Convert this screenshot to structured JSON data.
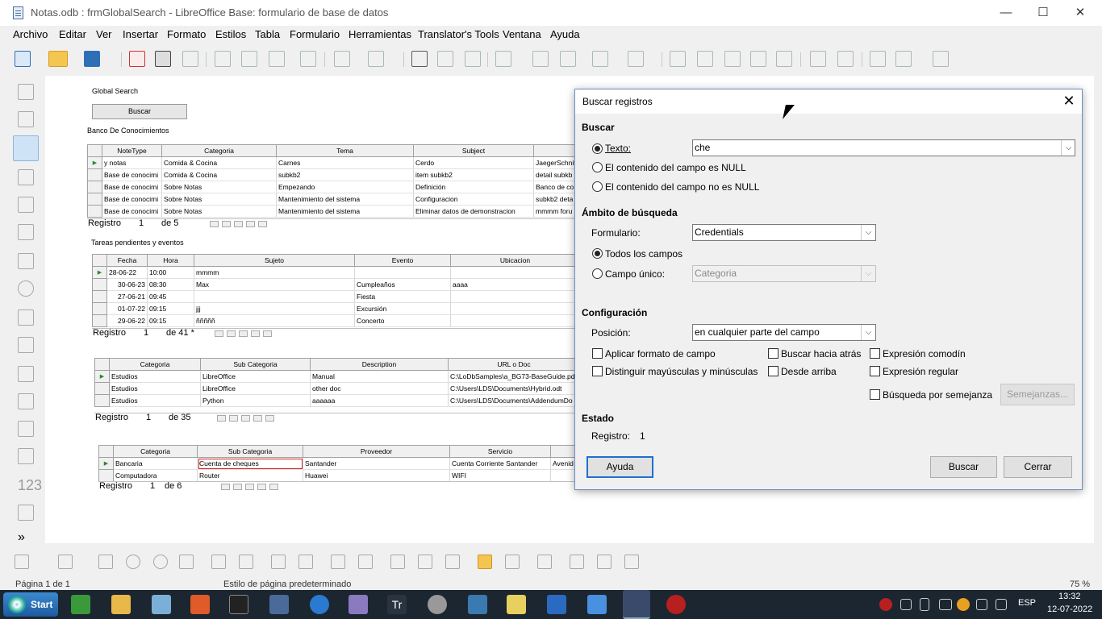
{
  "window": {
    "title": "Notas.odb : frmGlobalSearch - LibreOffice Base: formulario de base de datos",
    "minimize": "—",
    "maximize": "☐",
    "close": "✕"
  },
  "menu": [
    "Archivo",
    "Editar",
    "Ver",
    "Insertar",
    "Formato",
    "Estilos",
    "Tabla",
    "Formulario",
    "Herramientas",
    "Translator's Tools",
    "Ventana",
    "Ayuda"
  ],
  "form": {
    "global_search_label": "Global Search",
    "buscar_button": "Buscar",
    "banco_label": "Banco De Conocimientos",
    "banco_headers": [
      "NoteType",
      "Categoria",
      "Tema",
      "Subject",
      ""
    ],
    "banco_rows": [
      [
        "y notas",
        "Comida & Cocina",
        "Carnes",
        "Cerdo",
        "JaegerSchnit"
      ],
      [
        "Base de conocimi",
        "Comida & Cocina",
        "subkb2",
        "item subkb2",
        "detail subkb"
      ],
      [
        "Base de conocimi",
        "Sobre Notas",
        "Empezando",
        "Definición",
        "Banco de co"
      ],
      [
        "Base de conocimi",
        "Sobre Notas",
        "Mantenimiento del sistema",
        "Configuracion",
        "subkb2 deta"
      ],
      [
        "Base de conocimi",
        "Sobre Notas",
        "Mantenimiento del sistema",
        "Eliminar datos de demonstracion",
        "mmmm foru"
      ]
    ],
    "banco_nav": {
      "registro": "Registro",
      "num": "1",
      "of": "de 5"
    },
    "tareas_label": "Tareas pendientes y eventos",
    "tareas_headers": [
      "Fecha",
      "Hora",
      "Sujeto",
      "Evento",
      "Ubicacion"
    ],
    "tareas_rows": [
      [
        "28-06-22",
        "10:00",
        "mmmm",
        "",
        ""
      ],
      [
        "30-06-23",
        "08:30",
        "Max",
        "Cumpleaños",
        "aaaa"
      ],
      [
        "27-06-21",
        "09:45",
        "",
        "Fiesta",
        ""
      ],
      [
        "01-07-22",
        "09:15",
        "jjj",
        "Excursión",
        ""
      ],
      [
        "29-06-22",
        "09:15",
        "ñññññ",
        "Concerto",
        ""
      ]
    ],
    "tareas_nav": {
      "registro": "Registro",
      "num": "1",
      "of": "de 41 *"
    },
    "docs_headers": [
      "Categoria",
      "Sub Categoria",
      "Description",
      "URL o Doc"
    ],
    "docs_rows": [
      [
        "Estudios",
        "LibreOffice",
        "Manual",
        "C:\\LoDbSamples\\a_BG73-BaseGuide.pdf"
      ],
      [
        "Estudios",
        "LibreOffice",
        "other doc",
        "C:\\Users\\LDS\\Documents\\Hybrid.odt"
      ],
      [
        "Estudios",
        "Python",
        "aaaaaa",
        "C:\\Users\\LDS\\Documents\\AddendumDo"
      ]
    ],
    "docs_nav": {
      "registro": "Registro",
      "num": "1",
      "of": "de 35"
    },
    "cred_headers": [
      "Categoria",
      "Sub Categoria",
      "Proveedor",
      "Servicio",
      ""
    ],
    "cred_rows": [
      [
        "Bancaria",
        "Cuenta de cheques",
        "Santander",
        "Cuenta Corriente Santander",
        "Avenid"
      ],
      [
        "Computadora",
        "Router",
        "Huawei",
        "WIFI",
        ""
      ]
    ],
    "cred_nav": {
      "registro": "Registro",
      "num": "1",
      "of": "de 6"
    }
  },
  "dialog": {
    "title": "Buscar registros",
    "close": "✕",
    "buscar_section": "Buscar",
    "texto_label": "Texto:",
    "texto_value": "che",
    "null_label": "El contenido del campo es NULL",
    "notnull_label": "El contenido del campo no es NULL",
    "ambito_section": "Ámbito de búsqueda",
    "formulario_label": "Formulario:",
    "formulario_value": "Credentials",
    "todos_label": "Todos los campos",
    "campo_label": "Campo único:",
    "campo_value": "Categoria",
    "config_section": "Configuración",
    "posicion_label": "Posición:",
    "posicion_value": "en cualquier parte del campo",
    "opt_aplicar": "Aplicar formato de campo",
    "opt_distinguir": "Distinguir mayúsculas y minúsculas",
    "opt_hacia_atras": "Buscar hacia atrás",
    "opt_desde_arriba": "Desde arriba",
    "opt_comodin": "Expresión comodín",
    "opt_regular": "Expresión regular",
    "opt_semejanza": "Búsqueda por semejanza",
    "semejanzas_button": "Semejanzas...",
    "estado_section": "Estado",
    "registro_label": "Registro:",
    "registro_value": "1",
    "ayuda_button": "Ayuda",
    "buscar_button": "Buscar",
    "cerrar_button": "Cerrar"
  },
  "status": {
    "page": "Página 1 de 1",
    "style": "Estilo de página predeterminado",
    "zoom": "75 %"
  },
  "taskbar": {
    "start": "Start",
    "lang": "ESP",
    "time": "13:32",
    "date": "12-07-2022"
  }
}
